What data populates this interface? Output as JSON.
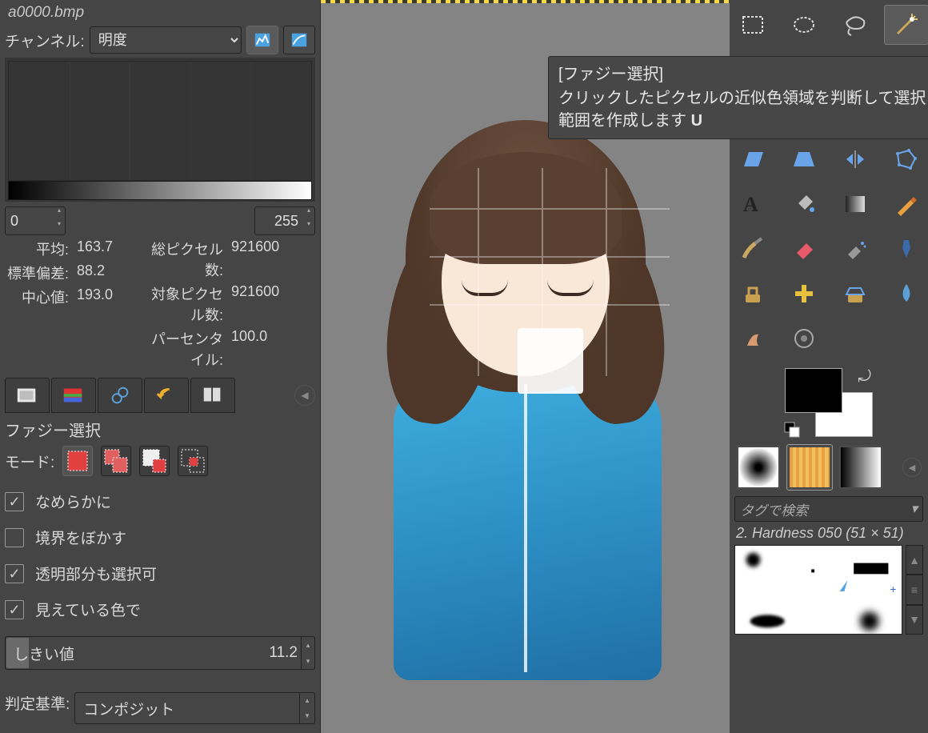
{
  "file": {
    "name": "a0000.bmp"
  },
  "histogram": {
    "channel_label": "チャンネル:",
    "channel_value": "明度",
    "range_min": "0",
    "range_max": "255",
    "stats": [
      {
        "k": "平均:",
        "v": "163.7"
      },
      {
        "k": "標準偏差:",
        "v": "88.2"
      },
      {
        "k": "中心値:",
        "v": "193.0"
      },
      {
        "k": "総ピクセル数:",
        "v": "921600"
      },
      {
        "k": "対象ピクセル数:",
        "v": "921600"
      },
      {
        "k": "パーセンタイル:",
        "v": "100.0"
      }
    ]
  },
  "tool_options": {
    "title": "ファジー選択",
    "mode_label": "モード:",
    "antialias": "なめらかに",
    "feather": "境界をぼかす",
    "select_transparent": "透明部分も選択可",
    "sample_merged": "見えている色で",
    "threshold_label": "しきい値",
    "threshold_value": "11.2",
    "criterion_label": "判定基準:",
    "criterion_value": "コンポジット"
  },
  "tooltip": {
    "title": "[ファジー選択]",
    "body": "クリックしたピクセルの近似色領域を判断して選択範囲を作成します",
    "shortcut": "U"
  },
  "right": {
    "tag_search_placeholder": "タグで検索",
    "active_brush": "2. Hardness 050 (51 × 51)"
  }
}
